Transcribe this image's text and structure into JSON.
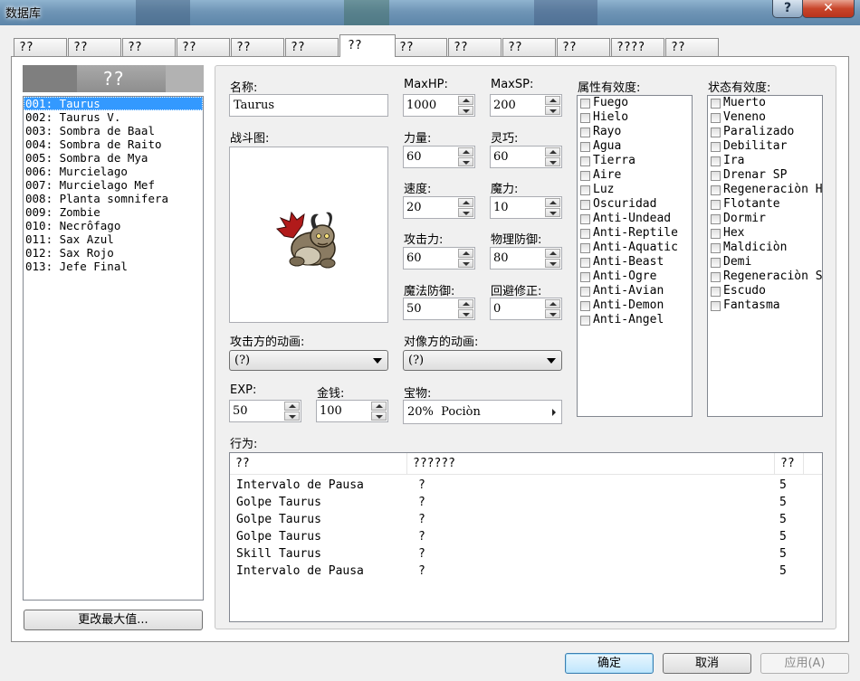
{
  "window": {
    "title": "数据库",
    "help_label": "?",
    "close_label": "✕"
  },
  "tabs": [
    "??",
    "??",
    "??",
    "??",
    "??",
    "??",
    "??",
    "??",
    "??",
    "??",
    "??",
    "????",
    "??"
  ],
  "active_tab": 6,
  "list": {
    "header": "??",
    "items": [
      "001: Taurus",
      "002: Taurus V.",
      "003: Sombra de Baal",
      "004: Sombra de Raito",
      "005: Sombra de Mya",
      "006: Murcielago",
      "007: Murcielago Mef",
      "008: Planta somnifera",
      "009: Zombie",
      "010: Necrôfago",
      "011: Sax Azul",
      "012: Sax Rojo",
      "013: Jefe Final"
    ],
    "selected_index": 0,
    "change_max_label": "更改最大值..."
  },
  "enemy": {
    "name_label": "名称:",
    "name": "Taurus",
    "battler_label": "战斗图:",
    "stats": {
      "maxhp_label": "MaxHP:",
      "maxhp": "1000",
      "maxsp_label": "MaxSP:",
      "maxsp": "200",
      "str_label": "力量:",
      "str": "60",
      "dex_label": "灵巧:",
      "dex": "60",
      "agi_label": "速度:",
      "agi": "20",
      "int_label": "魔力:",
      "int": "10",
      "atk_label": "攻击力:",
      "atk": "60",
      "pdef_label": "物理防御:",
      "pdef": "80",
      "mdef_label": "魔法防御:",
      "mdef": "50",
      "eva_label": "回避修正:",
      "eva": "0"
    },
    "anim_attacker_label": "攻击方的动画:",
    "anim_attacker": "(?)",
    "anim_target_label": "对像方的动画:",
    "anim_target": "(?)",
    "exp_label": "EXP:",
    "exp": "50",
    "gold_label": "金钱:",
    "gold": "100",
    "treasure_label": "宝物:",
    "treasure": "20%  Pociòn"
  },
  "element_rates": {
    "label": "属性有效度:",
    "items": [
      "Fuego",
      "Hielo",
      "Rayo",
      "Agua",
      "Tierra",
      "Aire",
      "Luz",
      "Oscuridad",
      "Anti-Undead",
      "Anti-Reptile",
      "Anti-Aquatic",
      "Anti-Beast",
      "Anti-Ogre",
      "Anti-Avian",
      "Anti-Demon",
      "Anti-Angel"
    ]
  },
  "state_rates": {
    "label": "状态有效度:",
    "items": [
      "Muerto",
      "Veneno",
      "Paralizado",
      "Debilitar",
      "Ira",
      "Drenar SP",
      "Regeneraciòn H",
      "Flotante",
      "Dormir",
      "Hex",
      "Maldiciòn",
      "Demi",
      "Regeneraciòn S",
      "Escudo",
      "Fantasma"
    ]
  },
  "actions": {
    "label": "行为:",
    "columns": [
      "??",
      "??????",
      "??"
    ],
    "rows": [
      [
        "Intervalo de Pausa",
        "?",
        "5"
      ],
      [
        "Golpe Taurus",
        "?",
        "5"
      ],
      [
        "Golpe Taurus",
        "?",
        "5"
      ],
      [
        "Golpe Taurus",
        "?",
        "5"
      ],
      [
        "Skill Taurus",
        "?",
        "5"
      ],
      [
        "Intervalo de Pausa",
        "?",
        "5"
      ]
    ]
  },
  "footer": {
    "ok_label": "确定",
    "cancel_label": "取消",
    "apply_label": "应用(A)"
  },
  "colors": {
    "selection": "#3399ff",
    "titlebar": "#6f95b6",
    "close": "#c8452a"
  }
}
